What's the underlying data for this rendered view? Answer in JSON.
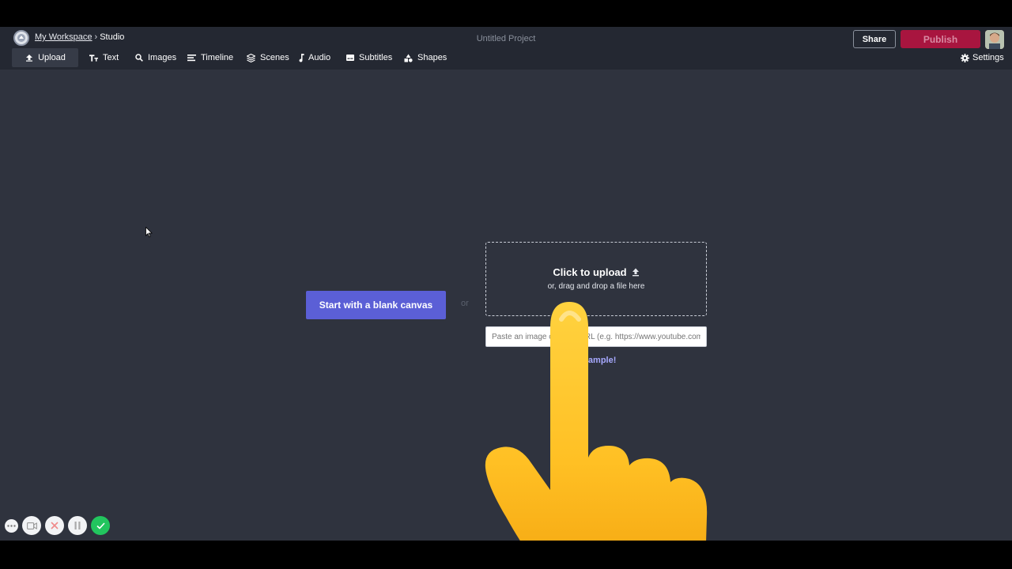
{
  "header": {
    "breadcrumb": {
      "workspace": "My Workspace",
      "separator": "›",
      "current": "Studio"
    },
    "project_title": "Untitled Project",
    "share_label": "Share",
    "publish_label": "Publish"
  },
  "toolbar": {
    "items": [
      {
        "label": "Upload",
        "icon": "upload-icon"
      },
      {
        "label": "Text",
        "icon": "text-icon"
      },
      {
        "label": "Images",
        "icon": "search-icon"
      },
      {
        "label": "Timeline",
        "icon": "timeline-icon"
      },
      {
        "label": "Scenes",
        "icon": "layers-icon"
      },
      {
        "label": "Audio",
        "icon": "music-note-icon"
      },
      {
        "label": "Subtitles",
        "icon": "subtitles-icon"
      },
      {
        "label": "Shapes",
        "icon": "shapes-icon"
      }
    ],
    "settings_label": "Settings"
  },
  "main": {
    "blank_canvas_label": "Start with a blank canvas",
    "or_label": "or",
    "upload": {
      "title": "Click to upload",
      "subtitle": "or, drag and drop a file here"
    },
    "url_input": {
      "placeholder": "Paste an image or video URL (e.g. https://www.youtube.com/"
    },
    "sample_link": "a sample!"
  },
  "colors": {
    "background": "#2f333e",
    "topbar": "#242832",
    "accent": "#5b5fd6",
    "publish": "#a8153f",
    "link": "#a7a9ff",
    "record_done": "#22c55e"
  }
}
